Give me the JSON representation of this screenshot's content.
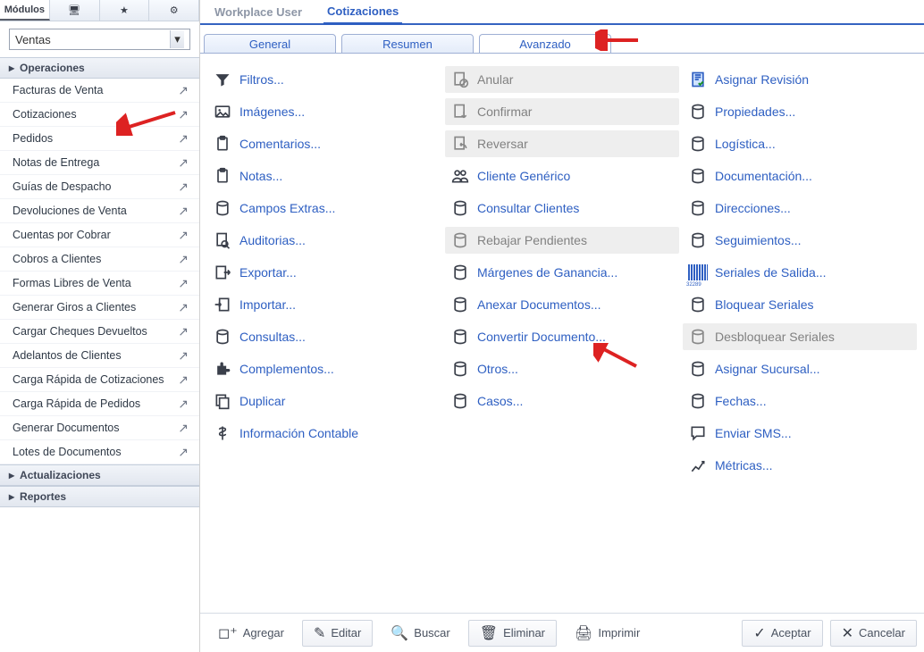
{
  "sidebar": {
    "tabs": [
      "Módulos",
      "",
      "",
      ""
    ],
    "active_tab": 0,
    "module_select": "Ventas",
    "groups": [
      {
        "label": "Operaciones",
        "expanded": true
      },
      {
        "label": "Actualizaciones",
        "expanded": false
      },
      {
        "label": "Reportes",
        "expanded": false
      }
    ],
    "items": [
      "Facturas de Venta",
      "Cotizaciones",
      "Pedidos",
      "Notas de Entrega",
      "Guías de Despacho",
      "Devoluciones de Venta",
      "Cuentas por Cobrar",
      "Cobros a Clientes",
      "Formas Libres de Venta",
      "Generar Giros a Clientes",
      "Cargar Cheques Devueltos",
      "Adelantos de Clientes",
      "Carga Rápida de Cotizaciones",
      "Carga Rápida de Pedidos",
      "Generar Documentos",
      "Lotes de Documentos"
    ]
  },
  "top_tabs": {
    "items": [
      "Workplace User",
      "Cotizaciones"
    ],
    "active": 1
  },
  "sub_tabs": {
    "items": [
      "General",
      "Resumen",
      "Avanzado"
    ],
    "active": 2
  },
  "tools": {
    "col1": [
      {
        "label": "Filtros...",
        "icon": "filter-icon",
        "disabled": false
      },
      {
        "label": "Imágenes...",
        "icon": "image-icon",
        "disabled": false
      },
      {
        "label": "Comentarios...",
        "icon": "clipboard-icon",
        "disabled": false
      },
      {
        "label": "Notas...",
        "icon": "note-icon",
        "disabled": false
      },
      {
        "label": "Campos Extras...",
        "icon": "database-icon",
        "disabled": false
      },
      {
        "label": "Auditorias...",
        "icon": "audit-icon",
        "disabled": false
      },
      {
        "label": "Exportar...",
        "icon": "export-icon",
        "disabled": false
      },
      {
        "label": "Importar...",
        "icon": "import-icon",
        "disabled": false
      },
      {
        "label": "Consultas...",
        "icon": "database-icon",
        "disabled": false
      },
      {
        "label": "Complementos...",
        "icon": "puzzle-icon",
        "disabled": false
      },
      {
        "label": "Duplicar",
        "icon": "duplicate-icon",
        "disabled": false
      },
      {
        "label": "Información Contable",
        "icon": "dollar-icon",
        "disabled": false
      }
    ],
    "col2": [
      {
        "label": "Anular",
        "icon": "cancel-doc-icon",
        "disabled": true
      },
      {
        "label": "Confirmar",
        "icon": "down-doc-icon",
        "disabled": true
      },
      {
        "label": "Reversar",
        "icon": "undo-doc-icon",
        "disabled": true
      },
      {
        "label": "Cliente Genérico",
        "icon": "people-icon",
        "disabled": false
      },
      {
        "label": "Consultar Clientes",
        "icon": "database-icon",
        "disabled": false
      },
      {
        "label": "Rebajar Pendientes",
        "icon": "database-icon",
        "disabled": true
      },
      {
        "label": "Márgenes de Ganancia...",
        "icon": "database-icon",
        "disabled": false
      },
      {
        "label": "Anexar Documentos...",
        "icon": "database-icon",
        "disabled": false
      },
      {
        "label": "Convertir Documento...",
        "icon": "database-icon",
        "disabled": false
      },
      {
        "label": "Otros...",
        "icon": "database-icon",
        "disabled": false
      },
      {
        "label": "Casos...",
        "icon": "database-icon",
        "disabled": false
      }
    ],
    "col3": [
      {
        "label": "Asignar Revisión",
        "icon": "doc-check-icon",
        "disabled": false
      },
      {
        "label": "Propiedades...",
        "icon": "database-icon",
        "disabled": false
      },
      {
        "label": "Logística...",
        "icon": "database-icon",
        "disabled": false
      },
      {
        "label": "Documentación...",
        "icon": "database-icon",
        "disabled": false
      },
      {
        "label": "Direcciones...",
        "icon": "database-icon",
        "disabled": false
      },
      {
        "label": "Seguimientos...",
        "icon": "database-icon",
        "disabled": false
      },
      {
        "label": "Seriales de Salida...",
        "icon": "barcode-icon",
        "disabled": false
      },
      {
        "label": "Bloquear Seriales",
        "icon": "database-icon",
        "disabled": false
      },
      {
        "label": "Desbloquear Seriales",
        "icon": "database-icon",
        "disabled": true
      },
      {
        "label": "Asignar Sucursal...",
        "icon": "database-icon",
        "disabled": false
      },
      {
        "label": "Fechas...",
        "icon": "database-icon",
        "disabled": false
      },
      {
        "label": "Enviar SMS...",
        "icon": "sms-icon",
        "disabled": false
      },
      {
        "label": "Métricas...",
        "icon": "chart-icon",
        "disabled": false
      }
    ]
  },
  "bottom": {
    "agregar": "Agregar",
    "editar": "Editar",
    "buscar": "Buscar",
    "eliminar": "Eliminar",
    "imprimir": "Imprimir",
    "aceptar": "Aceptar",
    "cancelar": "Cancelar"
  }
}
